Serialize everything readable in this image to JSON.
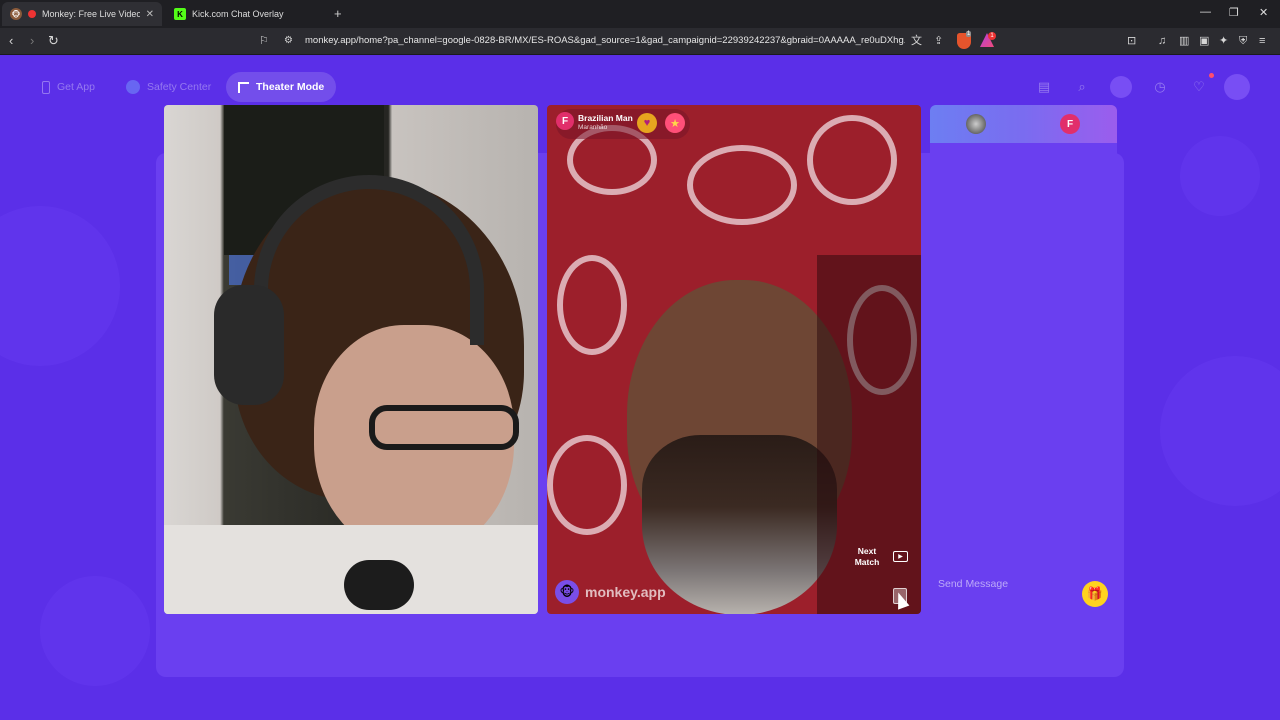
{
  "browser": {
    "tabs": [
      {
        "title": "Monkey: Free Live Video Chat",
        "active": true
      },
      {
        "title": "Kick.com Chat Overlay",
        "active": false
      }
    ],
    "url": "monkey.app/home?pa_channel=google-0828-BR/MX/ES-ROAS&gad_source=1&gad_campaignid=22939242237&gbraid=0AAAAA_re0uDXhg...",
    "brave_shield_count": "1",
    "rewards_count": "1"
  },
  "nav": {
    "get_app": "Get App",
    "safety_center": "Safety Center",
    "theater_mode": "Theater Mode"
  },
  "match": {
    "flag_letter": "F",
    "username": "Brazilian Man",
    "location": "Maranhão",
    "brand": "monkey.app",
    "next_match_line1": "Next",
    "next_match_line2": "Match"
  },
  "chat": {
    "partner_letter": "F",
    "placeholder": "Send Message"
  },
  "colors": {
    "page_bg": "#5b2fe8",
    "accent_gift": "#ffd21f",
    "partner_badge": "#e12f6b"
  }
}
